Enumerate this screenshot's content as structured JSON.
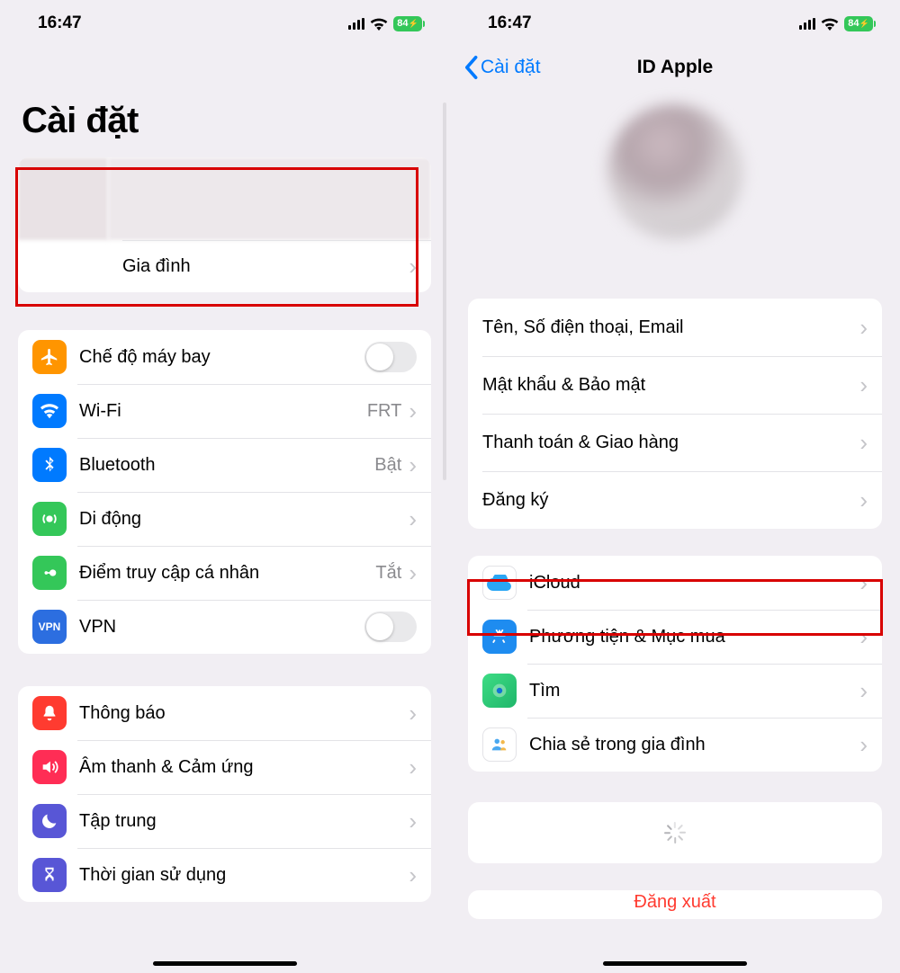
{
  "status": {
    "time": "16:47",
    "battery": "84"
  },
  "left": {
    "title": "Cài đặt",
    "profile_sub": "Gia đình",
    "rows": {
      "airplane": "Chế độ máy bay",
      "wifi": "Wi-Fi",
      "wifi_value": "FRT",
      "bluetooth": "Bluetooth",
      "bluetooth_value": "Bật",
      "cellular": "Di động",
      "hotspot": "Điểm truy cập cá nhân",
      "hotspot_value": "Tắt",
      "vpn": "VPN",
      "notifications": "Thông báo",
      "sounds": "Âm thanh & Cảm ứng",
      "focus": "Tập trung",
      "screentime": "Thời gian sử dụng"
    }
  },
  "right": {
    "back": "Cài đặt",
    "title": "ID Apple",
    "rows": {
      "name": "Tên, Số điện thoại, Email",
      "password": "Mật khẩu & Bảo mật",
      "payment": "Thanh toán & Giao hàng",
      "subscriptions": "Đăng ký",
      "icloud": "iCloud",
      "media": "Phương tiện & Mục mua",
      "find": "Tìm",
      "family": "Chia sẻ trong gia đình"
    },
    "signout": "Đăng xuất"
  }
}
